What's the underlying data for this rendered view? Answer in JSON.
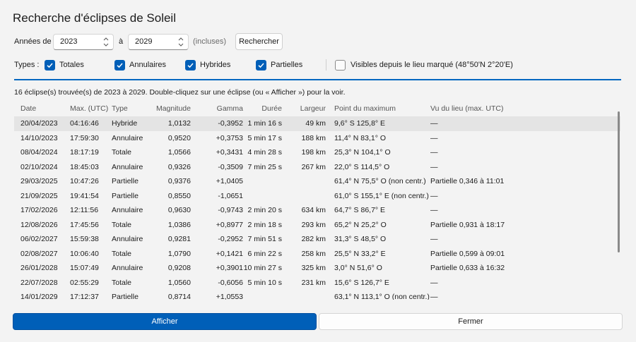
{
  "window": {
    "title": "Recherche d'éclipses de Soleil"
  },
  "filters": {
    "years_from_label": "Années de",
    "year_from": "2023",
    "to_label": "à",
    "year_to": "2029",
    "inclusive_label": "(incluses)",
    "search_button": "Rechercher",
    "types_label": "Types :",
    "types": [
      {
        "label": "Totales",
        "checked": true
      },
      {
        "label": "Annulaires",
        "checked": true
      },
      {
        "label": "Hybrides",
        "checked": true
      },
      {
        "label": "Partielles",
        "checked": true
      }
    ],
    "visible_label": "Visibles depuis le lieu marqué (48°50'N 2°20'E)",
    "visible_checked": false
  },
  "accent_color": "#0067c0",
  "status": "16 éclipse(s) trouvée(s) de 2023 à 2029. Double-cliquez sur une éclipse (ou « Afficher ») pour la voir.",
  "table": {
    "columns": [
      "Date",
      "Max. (UTC)",
      "Type",
      "Magnitude",
      "Gamma",
      "Durée",
      "Largeur",
      "Point du maximum",
      "Vu du lieu (max. UTC)"
    ],
    "selected_row": 0,
    "rows": [
      [
        "20/04/2023",
        "04:16:46",
        "Hybride",
        "1,0132",
        "-0,3952",
        "1 min 16 s",
        "49 km",
        "9,6° S  125,8° E",
        "—"
      ],
      [
        "14/10/2023",
        "17:59:30",
        "Annulaire",
        "0,9520",
        "+0,3753",
        "5 min 17 s",
        "188 km",
        "11,4° N  83,1° O",
        "—"
      ],
      [
        "08/04/2024",
        "18:17:19",
        "Totale",
        "1,0566",
        "+0,3431",
        "4 min 28 s",
        "198 km",
        "25,3° N  104,1° O",
        "—"
      ],
      [
        "02/10/2024",
        "18:45:03",
        "Annulaire",
        "0,9326",
        "-0,3509",
        "7 min 25 s",
        "267 km",
        "22,0° S  114,5° O",
        "—"
      ],
      [
        "29/03/2025",
        "10:47:26",
        "Partielle",
        "0,9376",
        "+1,0405",
        "",
        "",
        "61,4° N  75,5° O (non centr.)",
        "Partielle 0,346 à 11:01"
      ],
      [
        "21/09/2025",
        "19:41:54",
        "Partielle",
        "0,8550",
        "-1,0651",
        "",
        "",
        "61,0° S  155,1° E (non centr.)",
        "—"
      ],
      [
        "17/02/2026",
        "12:11:56",
        "Annulaire",
        "0,9630",
        "-0,9743",
        "2 min 20 s",
        "634 km",
        "64,7° S  86,7° E",
        "—"
      ],
      [
        "12/08/2026",
        "17:45:56",
        "Totale",
        "1,0386",
        "+0,8977",
        "2 min 18 s",
        "293 km",
        "65,2° N  25,2° O",
        "Partielle 0,931 à 18:17"
      ],
      [
        "06/02/2027",
        "15:59:38",
        "Annulaire",
        "0,9281",
        "-0,2952",
        "7 min 51 s",
        "282 km",
        "31,3° S  48,5° O",
        "—"
      ],
      [
        "02/08/2027",
        "10:06:40",
        "Totale",
        "1,0790",
        "+0,1421",
        "6 min 22 s",
        "258 km",
        "25,5° N  33,2° E",
        "Partielle 0,599 à 09:01"
      ],
      [
        "26/01/2028",
        "15:07:49",
        "Annulaire",
        "0,9208",
        "+0,3901",
        "10 min 27 s",
        "325 km",
        "3,0° N  51,6° O",
        "Partielle 0,633 à 16:32"
      ],
      [
        "22/07/2028",
        "02:55:29",
        "Totale",
        "1,0560",
        "-0,6056",
        "5 min 10 s",
        "231 km",
        "15,6° S  126,7° E",
        "—"
      ],
      [
        "14/01/2029",
        "17:12:37",
        "Partielle",
        "0,8714",
        "+1,0553",
        "",
        "",
        "63,1° N  113,1° O (non centr.)",
        "—"
      ]
    ]
  },
  "buttons": {
    "show": "Afficher",
    "close": "Fermer"
  }
}
